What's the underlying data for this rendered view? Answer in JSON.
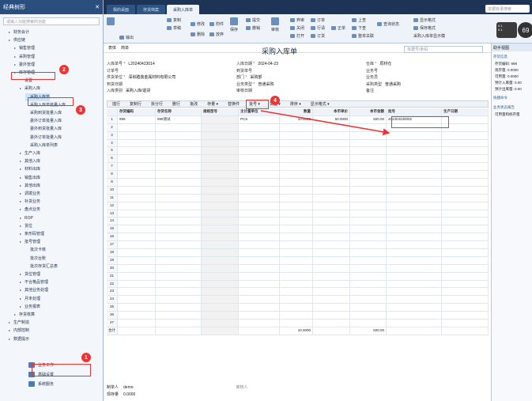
{
  "window": {
    "search_placeholder": "单据目录搜索"
  },
  "sidebar": {
    "title": "经典树形",
    "search_placeholder": "请输入功能搜索的功能",
    "items": [
      "财务会计",
      "供应链",
      "销售管理",
      "采购管理",
      "委外管理",
      "库存管理",
      "设置",
      "采购入库",
      "采购入库单",
      "采购入库单批量入库",
      "采购到货批量入库",
      "委外订单批量入库",
      "委外到货批量入库",
      "委外订单批量入库",
      "采购入库单列表",
      "生产入库",
      "其他入库",
      "材料出库",
      "销售出库",
      "其他出库",
      "调拨业务",
      "补货业务",
      "盘点业务",
      "ROP",
      "货位",
      "条形码管理",
      "批号管理",
      "批次卡核",
      "批次台账",
      "批次存货汇总表",
      "货位管理",
      "不合格品管理",
      "其他业务处理",
      "月末处理",
      "业务报表",
      "存货核算",
      "生产制造",
      "内部控制",
      "数据提示"
    ],
    "bottom": [
      "业务工作",
      "基础设置",
      "系统服务"
    ]
  },
  "tabs": [
    "我的桌面",
    "存货档案",
    "采购入库单"
  ],
  "ribbon": {
    "left": [
      "复制",
      "草稿",
      "输出"
    ],
    "mid1": [
      "修改",
      "删除",
      "放弃",
      "附件",
      "保存"
    ],
    "mid2": [
      "提交",
      "撤销",
      "审核",
      "弃审",
      "关闭",
      "打开",
      "订单",
      "行请",
      "订货",
      "正单",
      "上查",
      "下查",
      "整单关联",
      "查询状态",
      "显示格式",
      "保存格式",
      "采购入库单显示模"
    ]
  },
  "doc": {
    "title": "采购入库单",
    "subtabs": [
      "表体",
      "简单"
    ],
    "search_placeholder": "单据号/条码",
    "header": [
      {
        "label": "入库单号",
        "value": "L20240423014",
        "req": true
      },
      {
        "label": "入库日期",
        "value": "2024-04-23",
        "req": true
      },
      {
        "label": "仓库",
        "value": "原材仓",
        "req": true
      },
      {
        "label": "订单号",
        "value": ""
      },
      {
        "label": "到货单号",
        "value": ""
      },
      {
        "label": "业务号",
        "value": ""
      },
      {
        "label": "供货单位",
        "value": "深圳踏鼎金属材料有限公司",
        "req": true
      },
      {
        "label": "部门",
        "value": "采购部",
        "req": true
      },
      {
        "label": "业务员",
        "value": ""
      },
      {
        "label": "到货日期",
        "value": ""
      },
      {
        "label": "业务类型",
        "value": "普通采购",
        "req": true
      },
      {
        "label": "采购类型",
        "value": "普通采购"
      },
      {
        "label": "入库类别",
        "value": "采购入库/退货"
      },
      {
        "label": "审核日期",
        "value": ""
      },
      {
        "label": "备注",
        "value": ""
      }
    ]
  },
  "gridbar": [
    "插行",
    "复制行",
    "拆分行",
    "删行",
    "批改",
    "存量 ▾",
    "替换件",
    "批号 ▾",
    "货位 ▾",
    "排序 ▾",
    "显示格式 ▾"
  ],
  "grid": {
    "headers": [
      "",
      "存货编码",
      "存货名称",
      "规格型号",
      "主计量单位",
      "数量",
      "本币单价",
      "本币金额",
      "批号",
      "生产日期"
    ],
    "rows": [
      [
        "1",
        "999",
        "999测试",
        "",
        "PCS",
        "10.0000",
        "50.0000",
        "500.00",
        "202404230002",
        ""
      ]
    ],
    "empty_rows": 26,
    "total_label": "合计",
    "total_qty": "10.0000",
    "total_amt": "500.00"
  },
  "footer": {
    "maker_label": "制单人",
    "maker": "demo",
    "stock_label": "现存量",
    "stock": "0.0000",
    "auditor_label": "审核人"
  },
  "right": {
    "title": "助手视图",
    "sec1": "存货信息",
    "kv": [
      "存货编码: 999",
      "现存量: 0.0000",
      "可用量: 0.0000",
      "预计入库量: 0.00",
      "预计出库量: 0.00"
    ],
    "sec2": "快捷命令",
    "sec3": "业务状态报告",
    "kv2": [
      "可用量和统存量"
    ]
  },
  "markers": [
    "1",
    "2",
    "3",
    "4"
  ],
  "watermark": "CSDN @不想辞觉懂生",
  "speed": {
    "a": "0.1",
    "b": "0.1"
  },
  "round": "69"
}
